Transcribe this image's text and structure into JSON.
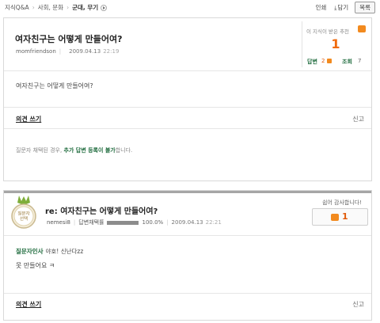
{
  "breadcrumb": {
    "items": [
      "지식Q&A",
      "사회, 문화",
      "군대, 무기"
    ]
  },
  "toolbar": {
    "print": "인쇄",
    "save": "담기",
    "list": "목록"
  },
  "question": {
    "title": "여자친구는 어떻게 만들어여?",
    "author": "momfriendson",
    "date": "2009.04.13",
    "time": "22:19",
    "recommend_label": "이 지식이 받은 추천",
    "recommend_count": "1",
    "answers_label": "답변",
    "answers_count": "2",
    "views_label": "조회",
    "views_count": "7",
    "body": "여자친구는 어떻게 만들어여?",
    "opinion_label": "의견 쓰기",
    "report_label": "신고",
    "note_prefix": "질문자 채택된 경우,",
    "note_highlight": "추가 답변 등록이 불가",
    "note_suffix": "합니다."
  },
  "answer": {
    "badge": [
      "질문자",
      "선택"
    ],
    "title": "re: 여자친구는 어떻게 만들어여?",
    "author": "nemesi8",
    "adopt_label": "답변채택률",
    "adopt_rate": "100.0%",
    "adopt_fraction": 1.0,
    "date": "2009.04.13",
    "time": "22:21",
    "thanks_label": "쉽어 감사합니다!",
    "thanks_count": "1",
    "greet_label": "질문자인사",
    "greet_text": "야호! 신난다zz",
    "body": "못 만들어요 ㅋ",
    "opinion_label": "의견 쓰기",
    "report_label": "신고"
  },
  "colors": {
    "accent_orange": "#f06a0b",
    "accent_green": "#1d6a3c",
    "border": "#d9d9d9"
  }
}
